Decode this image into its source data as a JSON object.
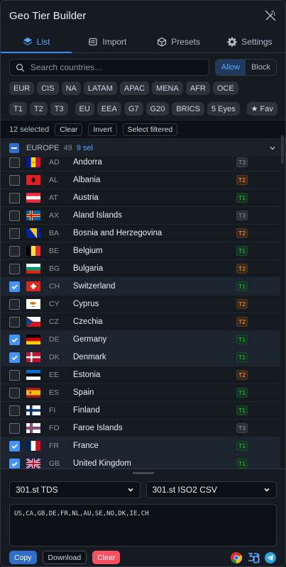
{
  "app": {
    "title": "Geo Tier Builder"
  },
  "tabs": [
    {
      "label": "List",
      "icon": "layers-icon",
      "active": true
    },
    {
      "label": "Import",
      "icon": "import-icon",
      "active": false
    },
    {
      "label": "Presets",
      "icon": "cube-icon",
      "active": false
    },
    {
      "label": "Settings",
      "icon": "gear-icon",
      "active": false
    }
  ],
  "search": {
    "placeholder": "Search countries…",
    "mode_allow": "Allow",
    "mode_block": "Block"
  },
  "region_chips": [
    "EUR",
    "CIS",
    "NA",
    "LATAM",
    "APAC",
    "MENA",
    "AFR",
    "OCE"
  ],
  "tier_chips": [
    "T1",
    "T2",
    "T3"
  ],
  "bloc_chips": [
    "EU",
    "EEA",
    "G7",
    "G20",
    "BRICS",
    "5 Eyes"
  ],
  "fav_chip": "★ Fav",
  "selection": {
    "count_text": "12 selected",
    "clear": "Clear",
    "invert": "Invert",
    "select_filtered": "Select filtered"
  },
  "group": {
    "name": "EUROPE",
    "count": "49",
    "selected": "9 sel"
  },
  "countries": [
    {
      "code": "AD",
      "name": "Andorra",
      "tier": "T3",
      "checked": false
    },
    {
      "code": "AL",
      "name": "Albania",
      "tier": "T2",
      "checked": false
    },
    {
      "code": "AT",
      "name": "Austria",
      "tier": "T1",
      "checked": false
    },
    {
      "code": "AX",
      "name": "Aland Islands",
      "tier": "T3",
      "checked": false
    },
    {
      "code": "BA",
      "name": "Bosnia and Herzegovina",
      "tier": "T2",
      "checked": false
    },
    {
      "code": "BE",
      "name": "Belgium",
      "tier": "T1",
      "checked": false
    },
    {
      "code": "BG",
      "name": "Bulgaria",
      "tier": "T2",
      "checked": false
    },
    {
      "code": "CH",
      "name": "Switzerland",
      "tier": "T1",
      "checked": true
    },
    {
      "code": "CY",
      "name": "Cyprus",
      "tier": "T2",
      "checked": false
    },
    {
      "code": "CZ",
      "name": "Czechia",
      "tier": "T2",
      "checked": false
    },
    {
      "code": "DE",
      "name": "Germany",
      "tier": "T1",
      "checked": true
    },
    {
      "code": "DK",
      "name": "Denmark",
      "tier": "T1",
      "checked": true
    },
    {
      "code": "EE",
      "name": "Estonia",
      "tier": "T2",
      "checked": false
    },
    {
      "code": "ES",
      "name": "Spain",
      "tier": "T1",
      "checked": false
    },
    {
      "code": "FI",
      "name": "Finland",
      "tier": "T1",
      "checked": false
    },
    {
      "code": "FO",
      "name": "Faroe Islands",
      "tier": "T3",
      "checked": false
    },
    {
      "code": "FR",
      "name": "France",
      "tier": "T1",
      "checked": true
    },
    {
      "code": "GB",
      "name": "United Kingdom",
      "tier": "T1",
      "checked": true
    }
  ],
  "export": {
    "format_select": "301.st TDS",
    "code_select": "301.st ISO2 CSV",
    "output": "US,CA,GB,DE,FR,NL,AU,SE,NO,DK,IE,CH",
    "copy": "Copy",
    "download": "Download",
    "clear": "Clear"
  },
  "footer_icons": [
    "chrome-icon",
    "brand-logo-icon",
    "telegram-icon"
  ]
}
